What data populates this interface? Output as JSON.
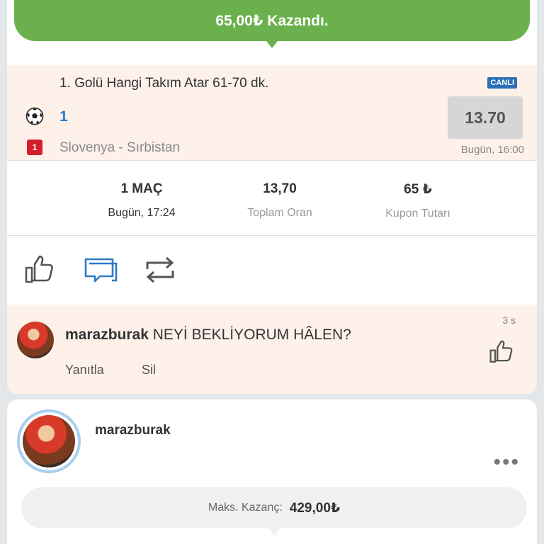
{
  "banner": {
    "text": "65,00₺ Kazandı."
  },
  "selection": {
    "market": "1. Golü Hangi Takım Atar 61-70 dk.",
    "live_badge": "CANLI",
    "pick": "1",
    "odd": "13.70",
    "red_badge": "1",
    "match": "Slovenya - Sırbistan",
    "match_time": "Bugün, 16:00"
  },
  "stats": [
    {
      "value": "1 MAÇ",
      "label": "Bugün, 17:24"
    },
    {
      "value": "13,70",
      "label": "Toplam Oran"
    },
    {
      "value": "65 ₺",
      "label": "Kupon Tutarı"
    }
  ],
  "actions": {
    "icons": [
      "thumb-up-icon",
      "comment-icon",
      "repost-icon"
    ]
  },
  "comment": {
    "username": "marazburak",
    "text": " NEYİ BEKLİYORUM HÂLEN?",
    "time": "3 s",
    "reply_label": "Yanıtla",
    "delete_label": "Sil"
  },
  "post2": {
    "username": "marazburak",
    "more": "•••",
    "maks_label": "Maks. Kazanç:",
    "maks_value": "429,00₺"
  },
  "colors": {
    "win_green": "#6ab04c",
    "live_blue": "#2c6fb7",
    "pick_blue": "#2c7ac5",
    "red_card": "#d41f2a",
    "selection_bg": "#fdf1ea",
    "avatar_ring": "#a8d0ee"
  }
}
